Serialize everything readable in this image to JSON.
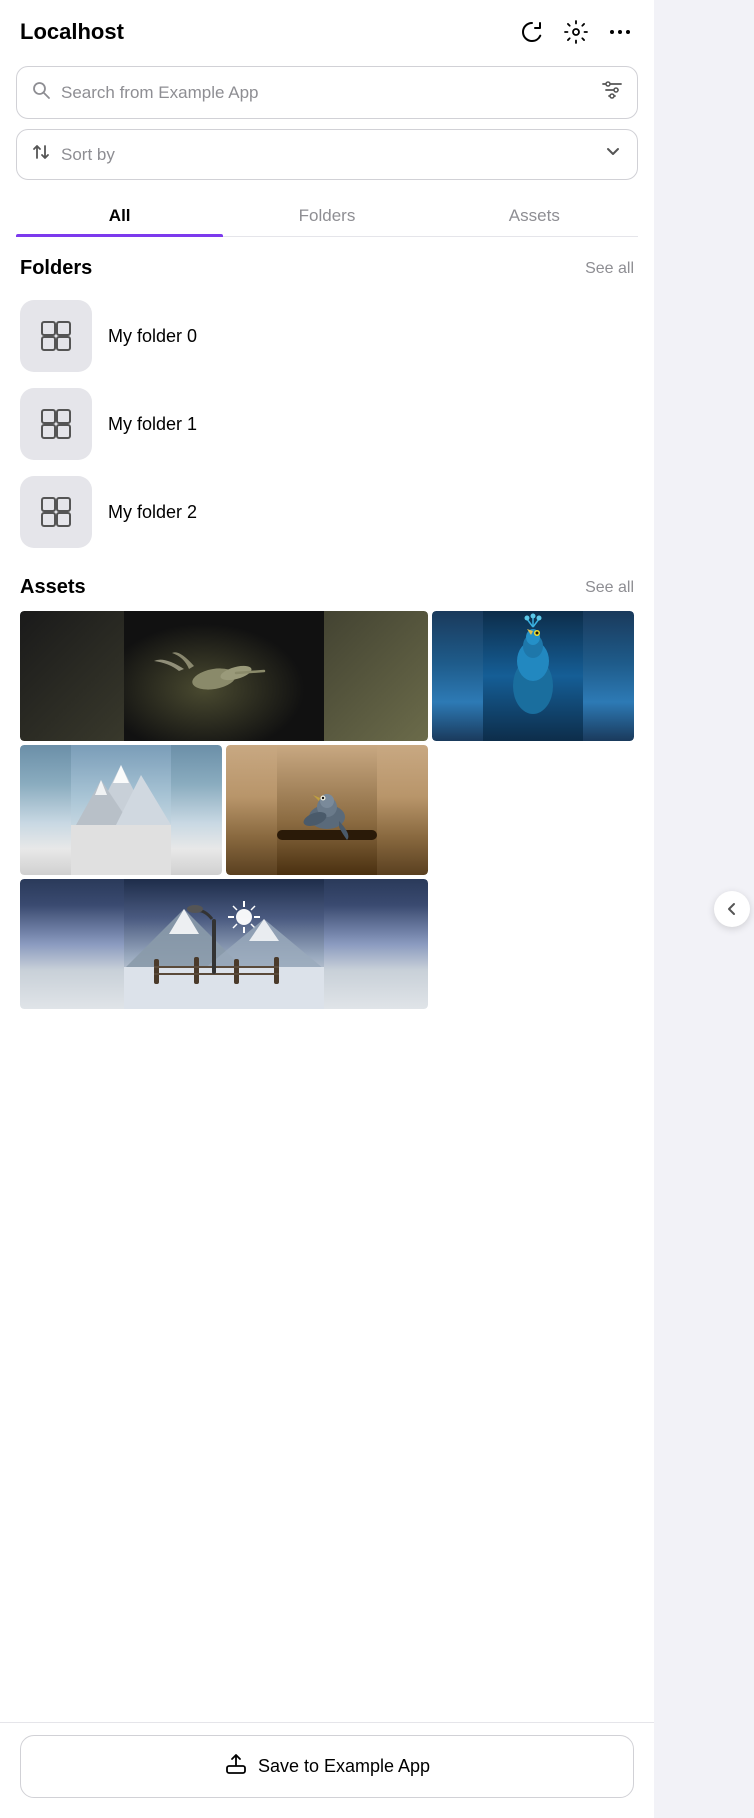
{
  "header": {
    "title": "Localhost",
    "icons": {
      "refresh": "↺",
      "settings": "⚙",
      "more": "•••"
    }
  },
  "search": {
    "placeholder": "Search from Example App",
    "filter_icon": "⊟"
  },
  "sort": {
    "label": "Sort by"
  },
  "tabs": [
    {
      "id": "all",
      "label": "All",
      "active": true
    },
    {
      "id": "folders",
      "label": "Folders",
      "active": false
    },
    {
      "id": "assets",
      "label": "Assets",
      "active": false
    }
  ],
  "folders_section": {
    "title": "Folders",
    "see_all": "See all",
    "items": [
      {
        "name": "My folder 0"
      },
      {
        "name": "My folder 1"
      },
      {
        "name": "My folder 2"
      }
    ]
  },
  "assets_section": {
    "title": "Assets",
    "see_all": "See all"
  },
  "save_button": {
    "label": "Save to Example App"
  }
}
